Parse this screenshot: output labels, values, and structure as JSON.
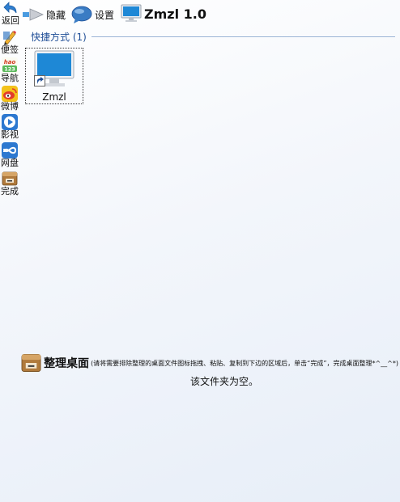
{
  "toolbar": {
    "back_label": "返回",
    "hide_label": "隐藏",
    "settings_label": "设置",
    "app_title": "Zmzl 1.0"
  },
  "sidebar": {
    "items": [
      {
        "label": "便签",
        "icon": "pencil-icon"
      },
      {
        "label": "导航",
        "icon": "hao123-icon"
      },
      {
        "label": "微博",
        "icon": "weibo-icon"
      },
      {
        "label": "影视",
        "icon": "play-icon"
      },
      {
        "label": "网盘",
        "icon": "cloud-drive-icon"
      },
      {
        "label": "完成",
        "icon": "box-icon"
      }
    ]
  },
  "section": {
    "title": "快捷方式 (1)"
  },
  "shortcut": {
    "name": "Zmzl",
    "icon": "monitor-icon"
  },
  "region": {
    "title": "整理桌面",
    "hint": "(请将需要排除整理的桌面文件图标拖拽、粘贴、复制到下边的区域后，单击“完成”，完成桌面整理*^__^*)",
    "empty_text": "该文件夹为空。"
  },
  "colors": {
    "accent": "#1f4e96",
    "monitor_screen": "#1e88d6",
    "box_brown": "#b07a3c"
  }
}
